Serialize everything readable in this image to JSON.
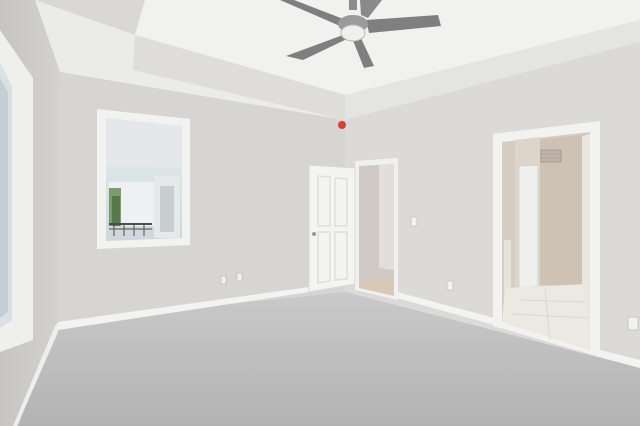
{
  "scene": {
    "colors": {
      "ceiling": "#e9e9e7",
      "tray": "#efefed",
      "wall_back": "#d8d6d4",
      "wall_right": "#dcdad8",
      "wall_left": "#cfcdcb",
      "carpet": "#bcbcbc",
      "baseboard": "#f2f2f0",
      "door": "#f4f4f2",
      "trim": "#f0f0ee",
      "room_beyond": "#d6cdc2",
      "tile": "#ece8e2",
      "fan_blade": "#7f7f7f",
      "smoke_detector": "#d9412f"
    }
  }
}
